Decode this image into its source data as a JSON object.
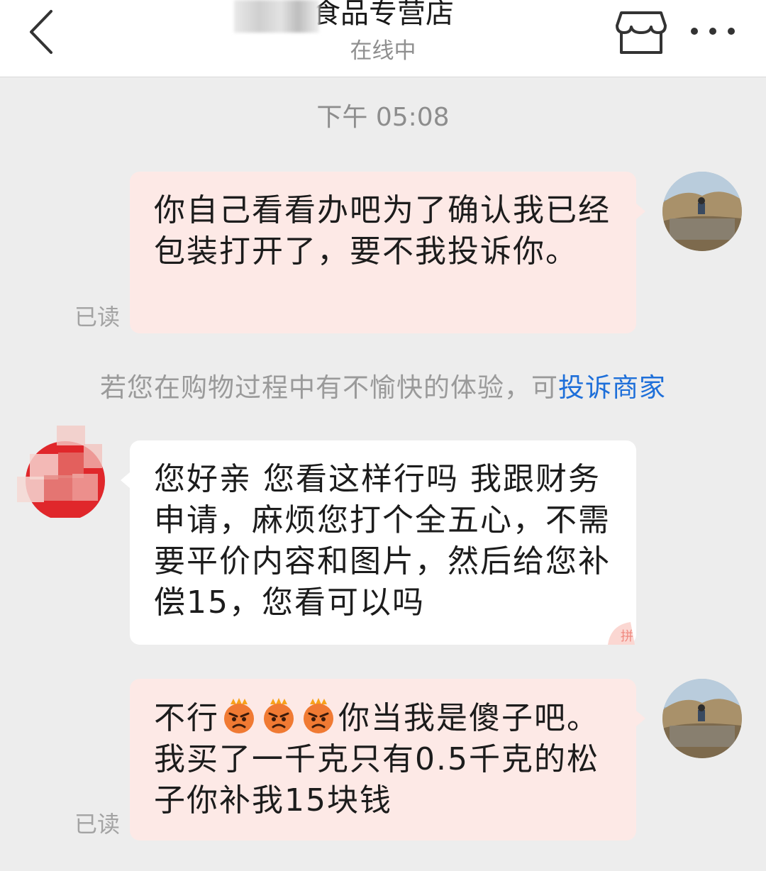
{
  "header": {
    "title": "食品专营店",
    "status": "在线中",
    "back_icon": "chevron-left-icon",
    "store_icon": "store-icon",
    "more_icon": "more-dots-icon"
  },
  "chat": {
    "timestamp": "下午 05:08",
    "messages": [
      {
        "side": "outgoing",
        "text": "你自己看看办吧为了确认我已经包装打开了，要不我投诉你。",
        "read": "已读"
      },
      {
        "side": "incoming",
        "text": "您好亲 您看这样行吗 我跟财务申请，麻烦您打个全五心，不需要平价内容和图片，然后给您补偿15，您看可以吗"
      },
      {
        "side": "outgoing",
        "text_before": "不行",
        "emoji": "angry-face-icon",
        "emoji_count": 3,
        "text_after": "你当我是傻子吧。我买了一千克只有0.5千克的松子你补我15块钱",
        "read": "已读"
      }
    ],
    "system_notice": {
      "text": "若您在购物过程中有不愉快的体验，可",
      "link": "投诉商家"
    }
  },
  "colors": {
    "background": "#ededed",
    "outgoing_bubble": "#fde9e6",
    "incoming_bubble": "#ffffff",
    "link": "#1e6fd9",
    "shop_avatar": "#e0272b"
  }
}
